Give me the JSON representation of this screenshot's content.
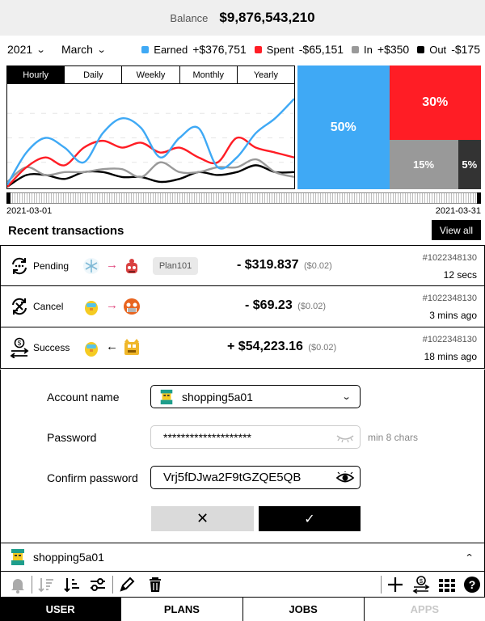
{
  "balance": {
    "label": "Balance",
    "value": "$9,876,543,210"
  },
  "filters": {
    "year": "2021",
    "month": "March"
  },
  "legend": [
    {
      "name": "Earned",
      "value": "+$376,751",
      "color": "#3fa9f5"
    },
    {
      "name": "Spent",
      "value": "-$65,151",
      "color": "#ff1d25"
    },
    {
      "name": "In",
      "value": "+$350",
      "color": "#999999"
    },
    {
      "name": "Out",
      "value": "-$175",
      "color": "#000000"
    }
  ],
  "chart_tabs": [
    "Hourly",
    "Daily",
    "Weekly",
    "Monthly",
    "Yearly"
  ],
  "active_chart_tab": "Hourly",
  "chart_data": [
    {
      "type": "line",
      "x": [
        1,
        2,
        3,
        4,
        5,
        6,
        7,
        8,
        9,
        10,
        11,
        12,
        13,
        14,
        15,
        16
      ],
      "ylim": [
        0,
        100
      ],
      "grid": true,
      "series": [
        {
          "name": "Earned",
          "color": "#3fa9f5",
          "values": [
            2,
            35,
            50,
            40,
            25,
            55,
            70,
            60,
            30,
            50,
            60,
            20,
            30,
            55,
            70,
            90
          ]
        },
        {
          "name": "Spent",
          "color": "#ff1d25",
          "values": [
            0,
            20,
            30,
            22,
            40,
            47,
            40,
            45,
            35,
            40,
            30,
            25,
            50,
            40,
            35,
            30
          ]
        },
        {
          "name": "In",
          "color": "#999999",
          "values": [
            5,
            20,
            12,
            15,
            15,
            18,
            18,
            10,
            25,
            15,
            15,
            20,
            20,
            28,
            15,
            10
          ]
        },
        {
          "name": "Out",
          "color": "#000000",
          "values": [
            0,
            12,
            12,
            8,
            15,
            15,
            10,
            10,
            5,
            8,
            15,
            12,
            15,
            22,
            15,
            15
          ]
        }
      ]
    },
    {
      "type": "treemap",
      "slices": [
        {
          "label": "Earned",
          "value": 50,
          "text": "50%",
          "color": "#3fa9f5"
        },
        {
          "label": "Spent",
          "value": 30,
          "text": "30%",
          "color": "#ff1d25"
        },
        {
          "label": "In",
          "value": 15,
          "text": "15%",
          "color": "#999999"
        },
        {
          "label": "Out",
          "value": 5,
          "text": "5%",
          "color": "#333333"
        }
      ]
    }
  ],
  "range": {
    "start": "2021-03-01",
    "end": "2021-03-31"
  },
  "recent": {
    "title": "Recent transactions",
    "view_all": "View all"
  },
  "transactions": [
    {
      "status": "Pending",
      "status_icon": "pending-icon",
      "direction": "right",
      "arrow": "→",
      "plan": "Plan101",
      "amount": "- $319.837",
      "fee": "($0.02)",
      "id": "#1022348130",
      "time": "12 secs"
    },
    {
      "status": "Cancel",
      "status_icon": "cancel-icon",
      "direction": "right",
      "arrow": "→",
      "plan": "",
      "amount": "- $69.23",
      "fee": "($0.02)",
      "id": "#1022348130",
      "time": "3 mins ago"
    },
    {
      "status": "Success",
      "status_icon": "success-icon",
      "direction": "left",
      "arrow": "←",
      "plan": "",
      "amount": "+ $54,223.16",
      "fee": "($0.02)",
      "id": "#1022348130",
      "time": "18 mins ago"
    }
  ],
  "form": {
    "account_label": "Account name",
    "account_value": "shopping5a01",
    "password_label": "Password",
    "password_value": "********************",
    "password_hint": "min 8 chars",
    "confirm_label": "Confirm password",
    "confirm_value": "Vrj5fDJwa2F9tGZQE5QB",
    "cancel_symbol": "✕",
    "ok_symbol": "✓"
  },
  "account_bar": {
    "name": "shopping5a01"
  },
  "toolbar_icons": [
    "bell-icon",
    "sort-icon",
    "sort-desc-icon",
    "sliders-icon",
    "pencil-icon",
    "trash-icon",
    "plus-icon",
    "money-transfer-icon",
    "grid-icon",
    "help-icon"
  ],
  "nav": [
    {
      "label": "USER",
      "state": "active"
    },
    {
      "label": "PLANS",
      "state": "normal"
    },
    {
      "label": "JOBS",
      "state": "normal"
    },
    {
      "label": "APPS",
      "state": "disabled"
    }
  ]
}
